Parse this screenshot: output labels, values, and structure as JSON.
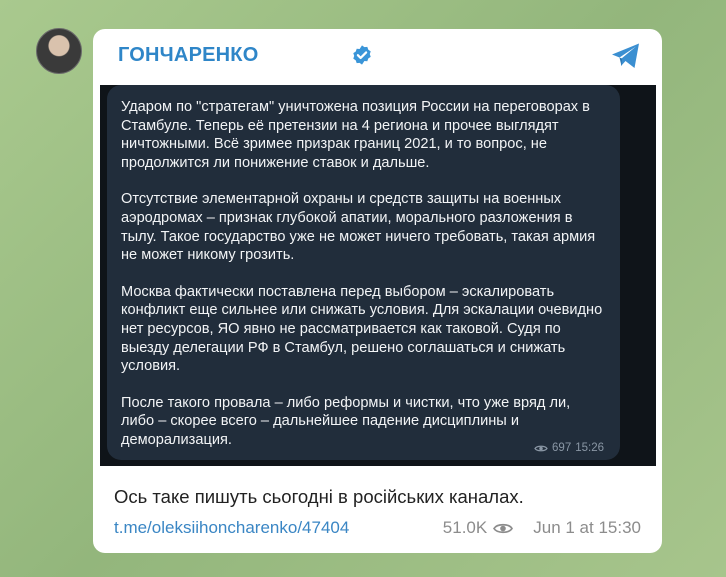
{
  "post": {
    "channel_name": "ГОНЧАРЕНКО",
    "caption": "Ось таке пишуть сьогодні в російських каналах.",
    "link_text": "t.me/oleksiihoncharenko/47404",
    "views": "51.0K",
    "date": "Jun 1 at 15:30"
  },
  "quoted_message": {
    "paragraphs": [
      "Ударом по \"стратегам\" уничтожена позиция России на переговорах в Стамбуле. Теперь её претензии на 4 региона и прочее выглядят ничтожными. Всё зримее призрак границ 2021, и то вопрос, не продолжится ли понижение ставок и дальше.",
      "Отсутствие элементарной охраны и средств защиты на военных аэродромах – признак глубокой апатии, морального разложения в тылу. Такое государство уже не может ничего требовать, такая армия не может никому грозить.",
      "Москва фактически поставлена перед выбором – эскалировать конфликт еще сильнее или снижать условия. Для эскалации очевидно нет ресурсов, ЯО явно не рассматривается как таковой. Судя по выезду делегации РФ в Стамбул, решено соглашаться и снижать условия.",
      "После такого провала – либо реформы и чистки, что уже вряд ли, либо – скорее всего – дальнейшее падение дисциплины и деморализация."
    ],
    "views": "697",
    "time": "15:26"
  },
  "icons": {
    "verified": "verified-badge-icon",
    "telegram": "telegram-logo-icon",
    "views": "eye-icon"
  },
  "colors": {
    "accent": "#2f86c8",
    "link": "#3a86c4",
    "dark_bubble": "#212d3b"
  }
}
